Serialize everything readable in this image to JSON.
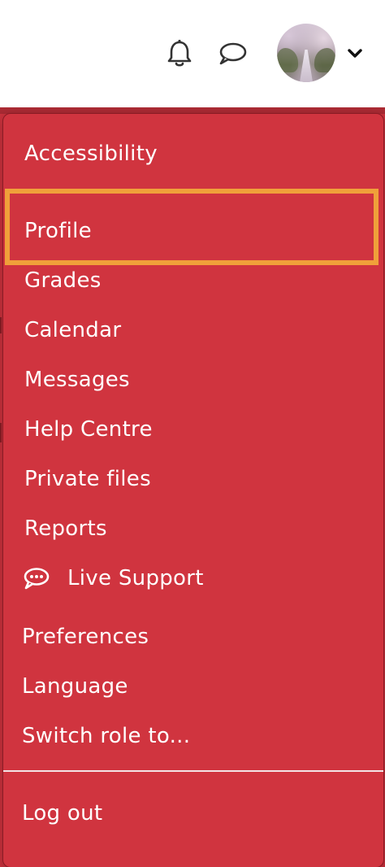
{
  "navbar": {
    "notifications_icon": "bell-icon",
    "messages_icon": "chat-bubble-icon",
    "avatar_alt": "user-avatar",
    "menu_toggle_icon": "chevron-down-icon"
  },
  "user_menu": {
    "items": [
      {
        "label": "Accessibility"
      },
      {
        "label": "Profile",
        "focused": true
      },
      {
        "label": "Grades"
      },
      {
        "label": "Calendar"
      },
      {
        "label": "Messages"
      },
      {
        "label": "Help Centre"
      },
      {
        "label": "Private files"
      },
      {
        "label": "Reports"
      },
      {
        "label": "Live Support",
        "icon": "speech-bubble-dots-icon"
      },
      {
        "label": "Preferences"
      },
      {
        "label": "Language"
      },
      {
        "label": "Switch role to..."
      },
      {
        "label": "Log out"
      }
    ]
  },
  "colors": {
    "menu_background": "#d0343f",
    "focus_outline": "#f0a03a",
    "text": "#ffffff"
  }
}
